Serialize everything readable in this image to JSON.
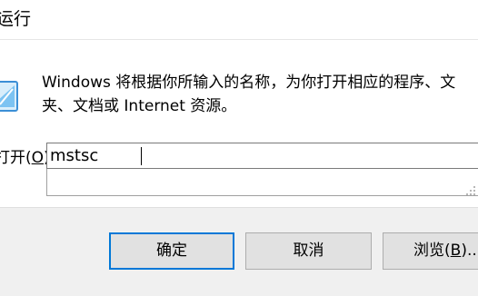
{
  "window": {
    "title": "运行"
  },
  "dialog": {
    "description_line1": "Windows 将根据你所输入的名称，为你打开相应的程序、文",
    "description_line2": "夹、文档或 Internet 资源。",
    "open_label_prefix": "打开(",
    "open_label_key": "O",
    "open_label_suffix": "):",
    "input_value": "mstsc",
    "icon": "run-icon"
  },
  "buttons": {
    "ok": "确定",
    "cancel": "取消",
    "browse_prefix": "浏览(",
    "browse_key": "B",
    "browse_suffix": ")..."
  },
  "colors": {
    "focus_border": "#0078d7",
    "button_bg": "#e1e1e1",
    "footer_bg": "#f0f0f0"
  }
}
